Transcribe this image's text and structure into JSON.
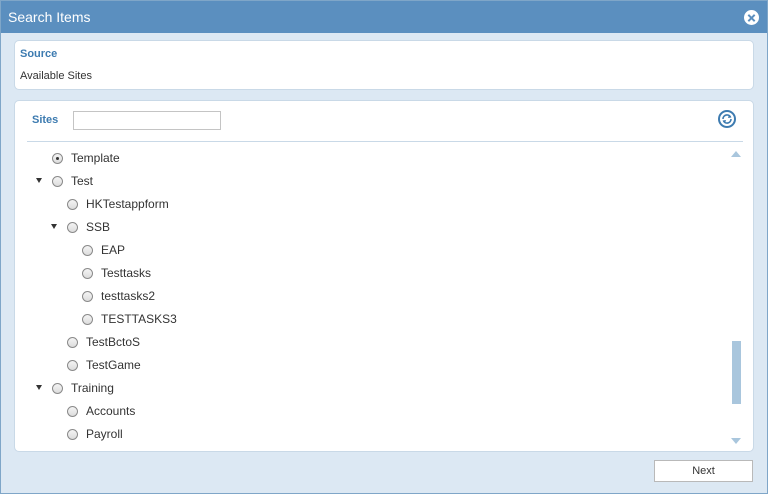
{
  "window": {
    "title": "Search Items",
    "close_icon": "close-icon"
  },
  "source": {
    "label": "Source",
    "value": "Available Sites"
  },
  "sites": {
    "label": "Sites",
    "search_value": "",
    "refresh_icon": "refresh-icon",
    "tree": [
      {
        "label": "Template",
        "level": 0,
        "expanded": null,
        "checked": true
      },
      {
        "label": "Test",
        "level": 0,
        "expanded": true,
        "checked": false
      },
      {
        "label": "HKTestappform",
        "level": 1,
        "expanded": null,
        "checked": false
      },
      {
        "label": "SSB",
        "level": 1,
        "expanded": true,
        "checked": false
      },
      {
        "label": "EAP",
        "level": 2,
        "expanded": null,
        "checked": false
      },
      {
        "label": "Testtasks",
        "level": 2,
        "expanded": null,
        "checked": false
      },
      {
        "label": "testtasks2",
        "level": 2,
        "expanded": null,
        "checked": false
      },
      {
        "label": "TESTTASKS3",
        "level": 2,
        "expanded": null,
        "checked": false
      },
      {
        "label": "TestBctoS",
        "level": 1,
        "expanded": null,
        "checked": false
      },
      {
        "label": "TestGame",
        "level": 1,
        "expanded": null,
        "checked": false
      },
      {
        "label": "Training",
        "level": 0,
        "expanded": true,
        "checked": false
      },
      {
        "label": "Accounts",
        "level": 1,
        "expanded": null,
        "checked": false
      },
      {
        "label": "Payroll",
        "level": 1,
        "expanded": null,
        "checked": false
      }
    ]
  },
  "footer": {
    "next_label": "Next"
  },
  "colors": {
    "titlebar": "#5b8fbf",
    "accent": "#3d7bb0",
    "background": "#dce8f3",
    "scrollbar": "#a9c6dd"
  }
}
